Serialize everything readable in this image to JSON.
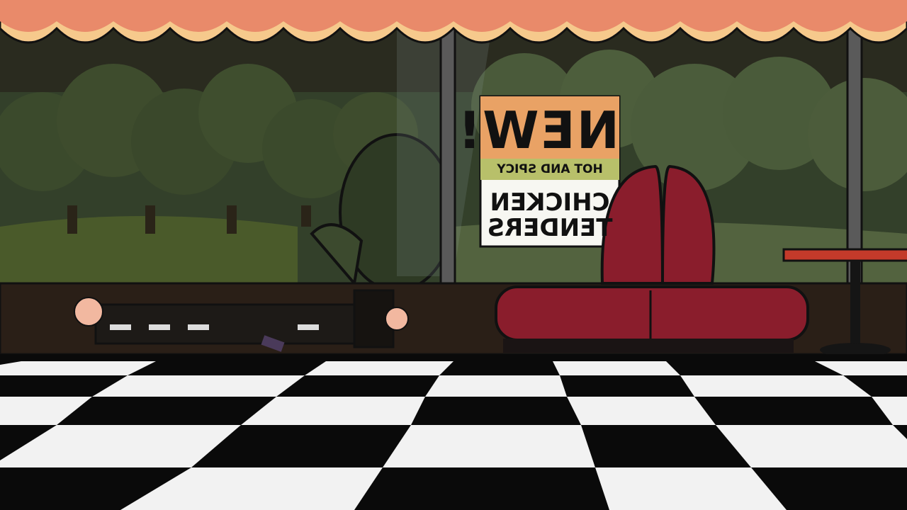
{
  "scene": {
    "name": "diner-window-scene",
    "poster": {
      "line1": "NEW!",
      "line2": "HOT AND SPICY",
      "line3": "CHICKEN",
      "line4": "TENDERS",
      "mirrored": true
    },
    "colors": {
      "awning_orange": "#e98a6a",
      "awning_cream": "#f6c98c",
      "foliage_dark": "#3e4a2c",
      "booth_red": "#8a1d2c",
      "floor_black": "#0a0a0a",
      "floor_white": "#f2f2f2",
      "table_top": "#c33a2a"
    }
  }
}
